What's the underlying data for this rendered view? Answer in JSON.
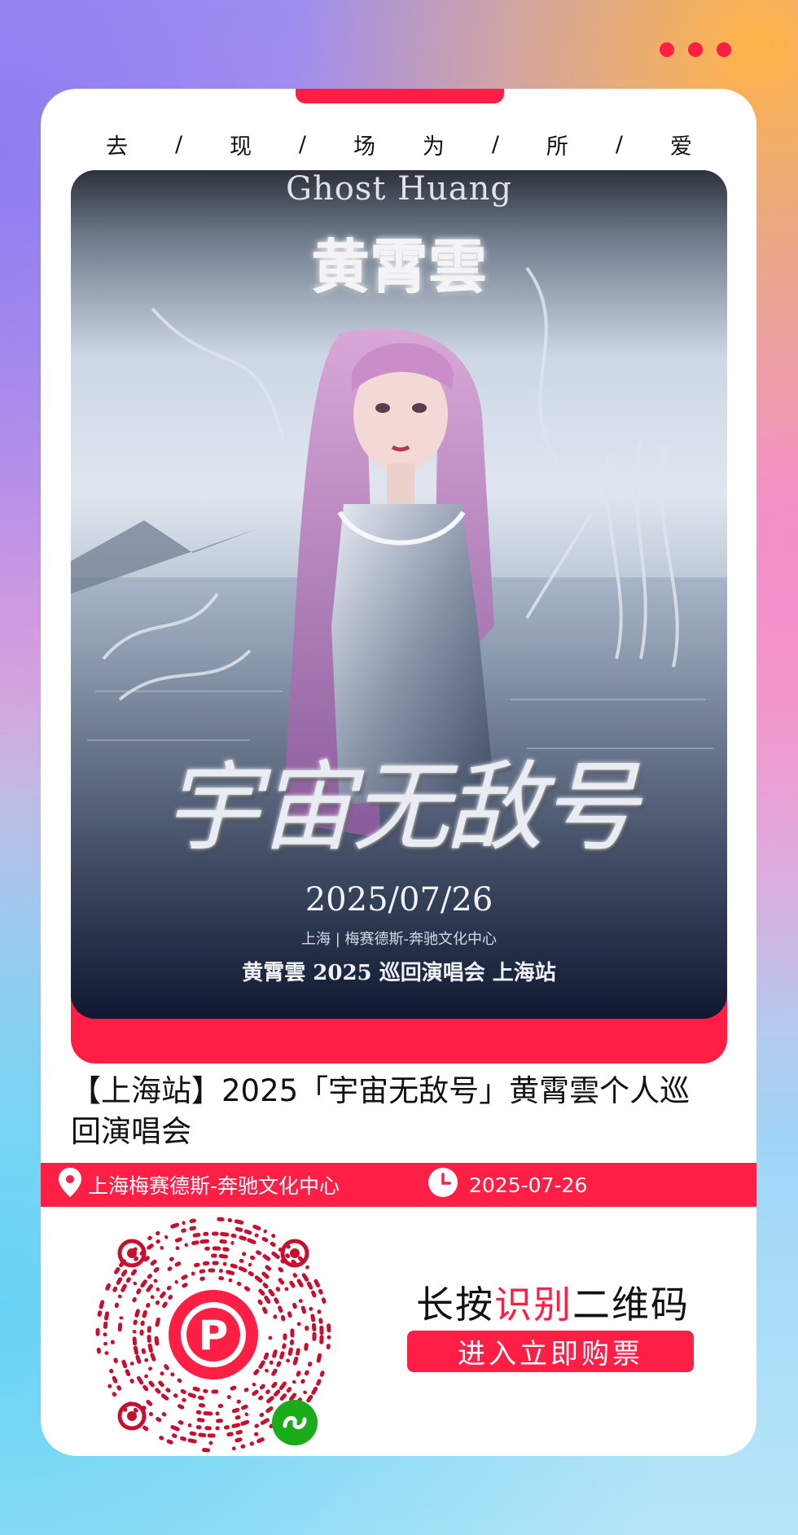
{
  "slogan": [
    "去",
    "/",
    "现",
    "/",
    "场",
    "为",
    "/",
    "所",
    "/",
    "爱"
  ],
  "poster": {
    "artist_en": "Ghost Huang",
    "artist_cn": "黄霄雲",
    "tour_art_text": "宇宙无敌号",
    "date": "2025/07/26",
    "venue_line": "上海 | 梅赛德斯-奔驰文化中心",
    "title_line": "黄霄雲 2025 巡回演唱会 上海站"
  },
  "event": {
    "title": "【上海站】2025「宇宙无敌号」黄霄雲个人巡回演唱会",
    "venue": "上海梅赛德斯-奔驰文化中心",
    "date": "2025-07-26"
  },
  "cta": {
    "part1": "长按",
    "highlight": "识别",
    "part2": "二维码",
    "button": "进入立即购票"
  },
  "icons": {
    "location": "location-pin-icon",
    "clock": "clock-icon",
    "more": "more-dots-icon",
    "mini_program": "mini-program-icon"
  },
  "colors": {
    "accent": "#ff1e44",
    "qr": "#c8102e",
    "mini_program": "#1aad19"
  }
}
